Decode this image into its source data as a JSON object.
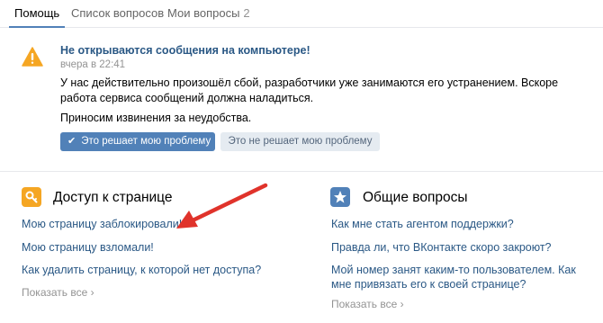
{
  "tabs": [
    {
      "label": "Помощь"
    },
    {
      "label": "Список вопросов"
    },
    {
      "label": "Мои вопросы",
      "count": "2"
    }
  ],
  "alert": {
    "title": "Не открываются сообщения на компьютере!",
    "time": "вчера в 22:41",
    "text": "У нас действительно произошёл сбой, разработчики уже занимаются его устранением. Вскоре работа сервиса сообщений должна наладиться.",
    "sorry": "Приносим извинения за неудобства.",
    "btn_yes": "Это решает мою проблему",
    "btn_no": "Это не решает мою проблему"
  },
  "sections": {
    "access": {
      "title": "Доступ к странице",
      "links": [
        "Мою страницу заблокировали!",
        "Мою страницу взломали!",
        "Как удалить страницу, к которой нет доступа?"
      ],
      "show_all": "Показать все"
    },
    "general": {
      "title": "Общие вопросы",
      "links": [
        "Как мне стать агентом поддержки?",
        "Правда ли, что ВКонтакте скоро закроют?",
        "Мой номер занят каким-то пользователем. Как мне привязать его к своей странице?"
      ],
      "show_all": "Показать все"
    }
  },
  "colors": {
    "accent": "#5181b8",
    "link": "#2a5885",
    "warning": "#f5a623",
    "arrow": "#e0332b"
  },
  "icons": [
    "warning-icon",
    "key-icon",
    "star-icon",
    "check-icon",
    "chevron-right-icon"
  ]
}
